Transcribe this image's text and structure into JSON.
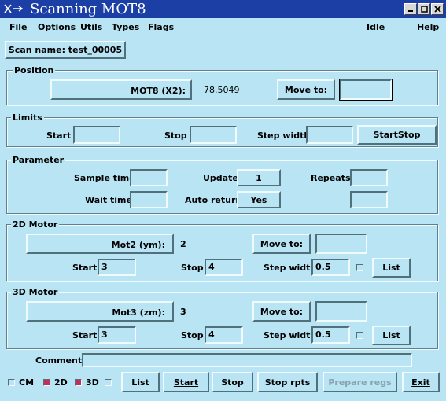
{
  "window": {
    "title": "Scanning MOT8",
    "icon": "x-arrow-icon",
    "controls": [
      "minimize-icon",
      "maximize-icon",
      "close-icon"
    ]
  },
  "menu": {
    "file": "File",
    "options": "Options",
    "utils": "Utils",
    "types": "Types",
    "flags": "Flags",
    "status": "Idle",
    "help": "Help"
  },
  "scan_name": "Scan name: test_00005",
  "position": {
    "legend": "Position",
    "motor_label": "MOT8 (X2):",
    "value": "78.5049",
    "move_to": "Move to:",
    "move_to_value": ""
  },
  "limits": {
    "legend": "Limits",
    "start_label": "Start",
    "start_value": "",
    "stop_label": "Stop",
    "stop_value": "",
    "step_label": "Step width",
    "step_value": "",
    "startstop_button": "StartStop"
  },
  "parameter": {
    "legend": "Parameter",
    "sample_time_label": "Sample time",
    "sample_time_value": "",
    "update_label": "Update",
    "update_value": "1",
    "repeats_label": "Repeats",
    "repeats_value": "",
    "wait_time_label": "Wait time",
    "wait_time_value": "",
    "auto_return_label": "Auto return",
    "auto_return_value": "Yes",
    "extra_value": ""
  },
  "motor2d": {
    "legend": "2D Motor",
    "motor_label": "Mot2 (ym):",
    "value": "2",
    "move_to": "Move to:",
    "move_to_value": "",
    "start_label": "Start",
    "start_value": "3",
    "stop_label": "Stop",
    "stop_value": "4",
    "step_label": "Step width",
    "step_value": "0.5",
    "list_button": "List"
  },
  "motor3d": {
    "legend": "3D Motor",
    "motor_label": "Mot3 (zm):",
    "value": "3",
    "move_to": "Move to:",
    "move_to_value": "",
    "start_label": "Start",
    "start_value": "3",
    "stop_label": "Stop",
    "stop_value": "4",
    "step_label": "Step width",
    "step_value": "0.5",
    "list_button": "List"
  },
  "comment": {
    "label": "Comment:",
    "value": ""
  },
  "bottom": {
    "cm_label": "CM",
    "cm_checked": false,
    "d2_label": "2D",
    "d2_checked": true,
    "d3_label": "3D",
    "d3_checked": true,
    "list_button": "List",
    "start_button": "Start",
    "stop_button": "Stop",
    "stop_rpts_button": "Stop rpts",
    "prepare_regs_button": "Prepare regs",
    "exit_button": "Exit"
  },
  "colors": {
    "background": "#b8e4f4",
    "titlebar": "#1b3fa4",
    "checked": "#c0305a"
  }
}
